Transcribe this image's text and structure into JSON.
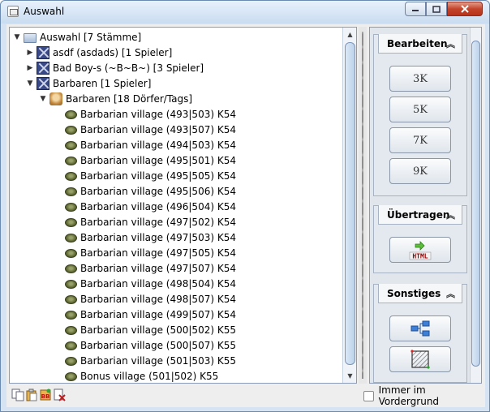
{
  "window": {
    "title": "Auswahl"
  },
  "tree": {
    "root": {
      "label": "Auswahl [7 Stämme]",
      "expanded": true
    },
    "tribes": [
      {
        "label": "asdf (asdads) [1 Spieler]",
        "expanded": false
      },
      {
        "label": "Bad Boy-s (~B~B~) [3 Spieler]",
        "expanded": false
      },
      {
        "label": "Barbaren [1 Spieler]",
        "expanded": true
      }
    ],
    "player": {
      "label": "Barbaren [18 Dörfer/Tags]",
      "expanded": true
    },
    "villages": [
      "Barbarian village (493|503) K54",
      "Barbarian village (493|507) K54",
      "Barbarian village (494|503) K54",
      "Barbarian village (495|501) K54",
      "Barbarian village (495|505) K54",
      "Barbarian village (495|506) K54",
      "Barbarian village (496|504) K54",
      "Barbarian village (497|502) K54",
      "Barbarian village (497|503) K54",
      "Barbarian village (497|505) K54",
      "Barbarian village (497|507) K54",
      "Barbarian village (498|504) K54",
      "Barbarian village (498|507) K54",
      "Barbarian village (499|507) K54",
      "Barbarian village (500|502) K55",
      "Barbarian village (500|507) K55",
      "Barbarian village (501|503) K55",
      "Bonus village (501|502) K55"
    ]
  },
  "panel": {
    "edit": {
      "title": "Bearbeiten",
      "buttons": [
        "3K",
        "5K",
        "7K",
        "9K"
      ]
    },
    "transfer": {
      "title": "Übertragen",
      "html_label": "HTML"
    },
    "misc": {
      "title": "Sonstiges"
    }
  },
  "footer": {
    "always_on_top": "Immer im Vordergrund",
    "checked": false
  },
  "colors": {
    "accent": "#6c8bb0",
    "close": "#c4432b"
  }
}
